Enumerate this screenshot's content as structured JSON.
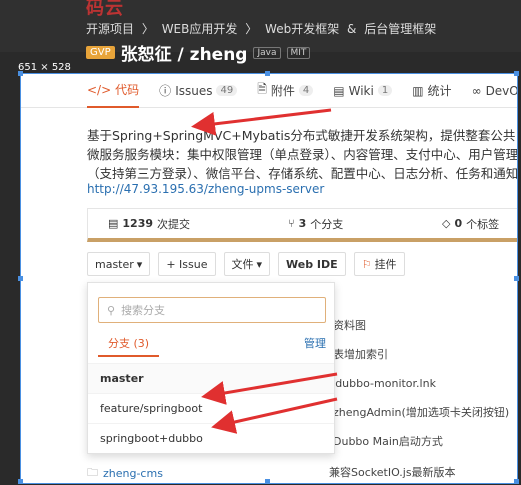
{
  "header": {
    "logo": "码云",
    "breadcrumbs": [
      "开源项目",
      "〉",
      "WEB应用开发",
      "〉",
      "Web开发框架",
      "&",
      "后台管理框架"
    ],
    "gvp_badge": "GVP",
    "project_title": "张恕征 / zheng",
    "tags": [
      "Java",
      "MIT"
    ]
  },
  "size_label": "651 × 528",
  "tabs": [
    {
      "icon": "</>",
      "label": "代码",
      "count": ""
    },
    {
      "icon": "ⓘ",
      "label": "Issues",
      "count": "49"
    },
    {
      "icon": "🗎",
      "label": "附件",
      "count": "4"
    },
    {
      "icon": "▤",
      "label": "Wiki",
      "count": "1"
    },
    {
      "icon": "▥",
      "label": "统计",
      "count": ""
    },
    {
      "icon": "∞",
      "label": "DevOps",
      "count": ""
    }
  ],
  "description": "基于Spring+SpringMVC+Mybatis分布式敏捷开发系统架构，提供整套公共微服务服务模块：集中权限管理（单点登录）、内容管理、支付中心、用户管理（支持第三方登录）、微信平台、存储系统、配置中心、日志分析、任务和通知等，支持服务治理、监控和追踪，努力为中小型企业打造全方位J2EE企业级开发解决方案。",
  "project_link": "http://47.93.195.63/zheng-upms-server",
  "stats": {
    "commits_num": "1239",
    "commits_label": "次提交",
    "branches_num": "3",
    "branches_label": "个分支",
    "tags_num": "0",
    "tags_label": "个标签"
  },
  "actions": {
    "branch_select": "master",
    "issue_button": "+ Issue",
    "file_button": "文件",
    "webide_button": "Web IDE",
    "mount_button": "挂件"
  },
  "dropdown": {
    "search_placeholder": "搜索分支",
    "tab_branches": "分支 (3)",
    "manage": "管理",
    "branches": [
      "master",
      "feature/springboot",
      "springboot+dubbo"
    ]
  },
  "files": [
    "d",
    "增加资料图",
    "日志表增加索引",
    "add dubbo-monitor.lnk",
    "更新zhengAdmin(增加选项卡关闭按钮)",
    "改为Dubbo Main启动方式"
  ],
  "bottom_file": {
    "name": "zheng-cms",
    "commit": "兼容SocketIO.js最新版本"
  },
  "colors": {
    "accent": "#e05a2b",
    "link": "#2a6fb0",
    "arrow": "#e03030"
  }
}
